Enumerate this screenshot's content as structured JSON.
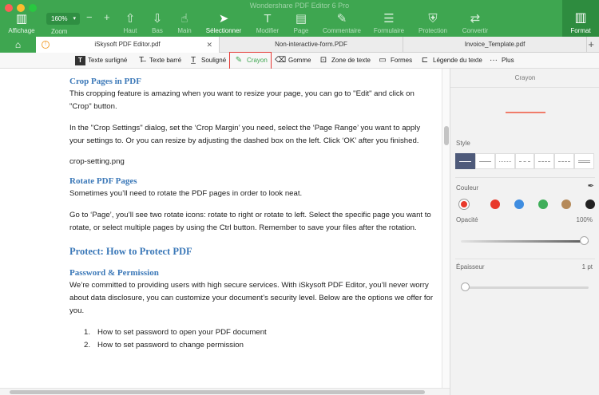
{
  "window": {
    "title": "Wondershare PDF Editor 6 Pro"
  },
  "toolbar": {
    "zoom_value": "160%",
    "zoom_minus": "−",
    "zoom_plus": "+",
    "items": [
      {
        "id": "affichage",
        "label": "Affichage",
        "icon": "▥"
      },
      {
        "id": "zoom",
        "label": "Zoom",
        "icon": ""
      },
      {
        "id": "haut",
        "label": "Haut",
        "icon": "⇧"
      },
      {
        "id": "bas",
        "label": "Bas",
        "icon": "⇩"
      },
      {
        "id": "main",
        "label": "Main",
        "icon": "☝"
      },
      {
        "id": "selectionner",
        "label": "Sélectionner",
        "icon": "➤"
      },
      {
        "id": "modifier",
        "label": "Modifier",
        "icon": "T"
      },
      {
        "id": "page",
        "label": "Page",
        "icon": "▤"
      },
      {
        "id": "commentaire",
        "label": "Commentaire",
        "icon": "✎"
      },
      {
        "id": "formulaire",
        "label": "Formulaire",
        "icon": "☰"
      },
      {
        "id": "protection",
        "label": "Protection",
        "icon": "⛨"
      },
      {
        "id": "convertir",
        "label": "Convertir",
        "icon": "⇄"
      }
    ],
    "format_label": "Format",
    "format_icon": "▥"
  },
  "tabs": {
    "home_icon": "⌂",
    "items": [
      {
        "label": "iSkysoft PDF Editor.pdf",
        "close": "✕",
        "warn": "!"
      },
      {
        "label": "Non-interactive-form.PDF"
      },
      {
        "label": "Invoice_Template.pdf"
      }
    ],
    "add": "+"
  },
  "annotations": {
    "items": [
      {
        "label": "Texte surligné",
        "icon": "T"
      },
      {
        "label": "Texte barré",
        "icon": "T̶"
      },
      {
        "label": "Souligné",
        "icon": "T̲"
      },
      {
        "label": "Crayon",
        "icon": "✎"
      },
      {
        "label": "Gomme",
        "icon": "⌫"
      },
      {
        "label": "Zone de texte",
        "icon": "⊡"
      },
      {
        "label": "Formes",
        "icon": "▭"
      },
      {
        "label": "Légende du texte",
        "icon": "⊏"
      },
      {
        "label": "Plus",
        "icon": "···"
      }
    ]
  },
  "document": {
    "h_crop": "Crop Pages in PDF",
    "p_crop1": "This cropping feature is amazing when you want to resize your page, you can go to \"Edit\" and click on \"Crop\" button.",
    "p_crop2": "In the \"Crop Settings\" dialog, set the ‘Crop Margin’ you need, select the ‘Page Range’ you want to apply your settings to. Or you can resize by adjusting the dashed box on the left. Click ‘OK’ after you finished.",
    "p_crop_img": "crop-setting.png",
    "h_rotate": "Rotate PDF Pages",
    "p_rotate1": "Sometimes you’ll need to rotate the PDF pages in order to look neat.",
    "p_rotate2": "Go to ‘Page’, you’ll see two rotate icons: rotate to right or rotate to left. Select the specific page you want to rotate, or select multiple pages by using the Ctrl button.  Remember to save your files after the rotation.",
    "h_protect": "Protect:  How to Protect PDF",
    "h_password": "Password & Permission",
    "p_password": "We’re committed to providing users with high secure services. With iSkysoft PDF Editor, you’ll never worry about data disclosure, you can customize your document’s security level. Below are the options we offer for you.",
    "list": [
      {
        "num": "1.",
        "text": "How to set password to open your PDF document"
      },
      {
        "num": "2.",
        "text": "How to set password to change permission"
      }
    ]
  },
  "panel": {
    "title": "Crayon",
    "style_label": "Style",
    "color_label": "Couleur",
    "opacity_label": "Opacité",
    "opacity_value": "100%",
    "opacity_level": 1.0,
    "thickness_label": "Épaisseur",
    "thickness_value": "1 pt",
    "thickness_level": 0.0,
    "picker_icon": "✒",
    "swatches": [
      "#e8392b",
      "#e8392b",
      "#3f8de0",
      "#3fae5a",
      "#b58a5a",
      "#222222"
    ],
    "selected_swatch": 0
  }
}
